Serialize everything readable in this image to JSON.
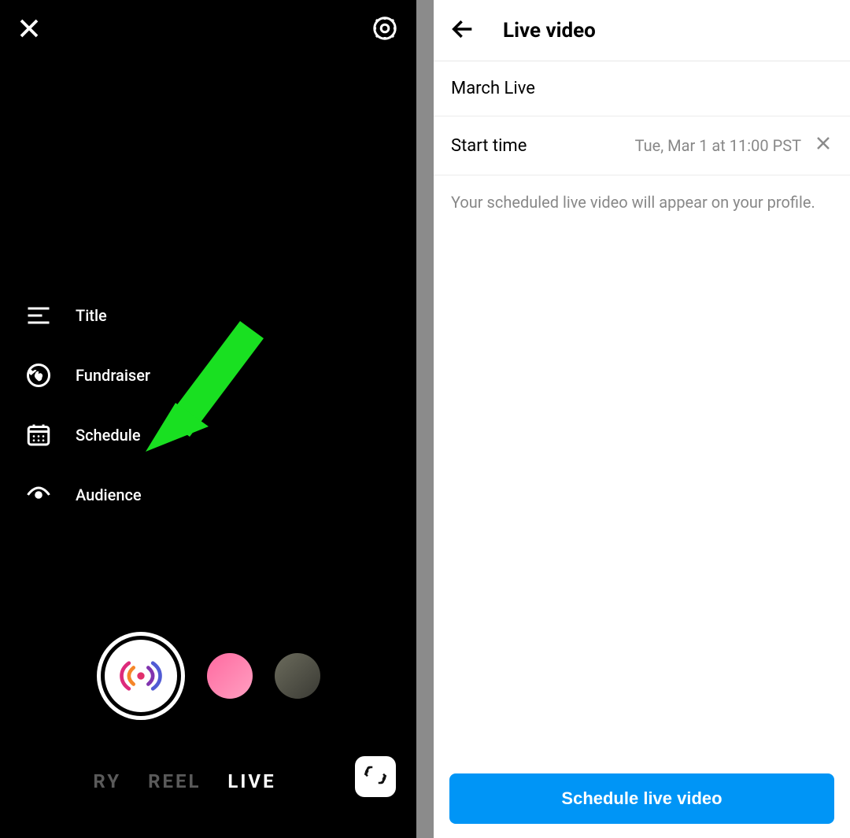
{
  "left": {
    "options": {
      "title": "Title",
      "fundraiser": "Fundraiser",
      "schedule": "Schedule",
      "audience": "Audience"
    },
    "modes": {
      "story_partial": "RY",
      "reel": "REEL",
      "live": "LIVE"
    }
  },
  "right": {
    "header_title": "Live video",
    "title_value": "March Live",
    "start_time_label": "Start time",
    "start_time_value": "Tue, Mar 1 at 11:00 PST",
    "note": "Your scheduled live video will appear on your profile.",
    "schedule_button": "Schedule live video"
  },
  "colors": {
    "accent_green": "#19e021",
    "primary_blue": "#0095f6"
  }
}
